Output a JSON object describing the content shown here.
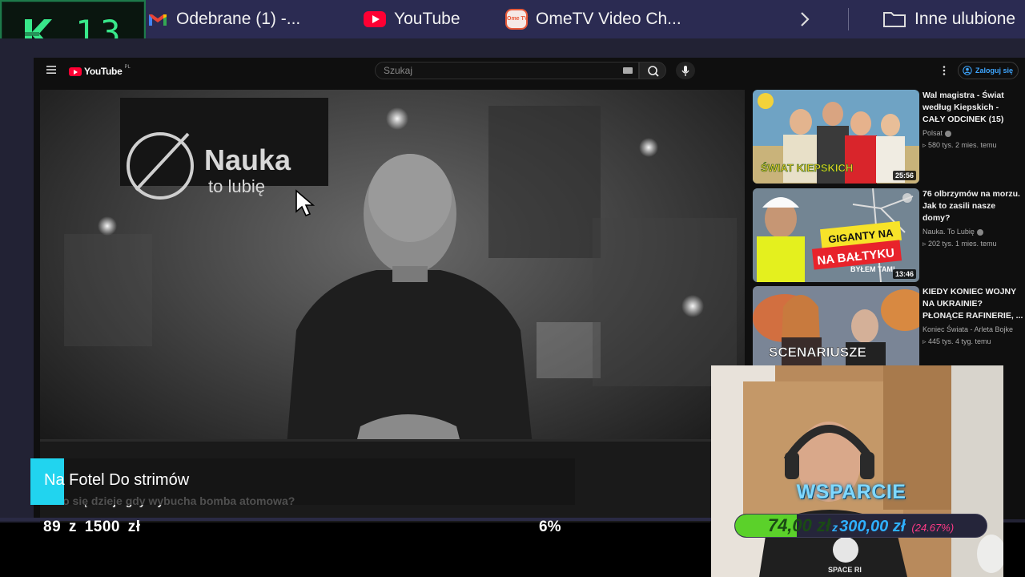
{
  "browser": {
    "bookmarks": [
      {
        "label": "Odebrane (1) -...",
        "icon": "gmail-icon"
      },
      {
        "label": "YouTube",
        "icon": "youtube-icon"
      },
      {
        "label": "OmeTV Video Ch...",
        "icon": "ometv-icon"
      }
    ],
    "other_bookmarks": "Inne ulubione",
    "ometv_icon_text": "Ome TV"
  },
  "counter": {
    "letter": "K",
    "value": "13"
  },
  "youtube": {
    "logo_text": "YouTube",
    "logo_suffix": "PL",
    "search_placeholder": "Szukaj",
    "signin_label": "Zaloguj się",
    "video": {
      "title": "Co się dzieje gdy wybucha bomba atomowa?",
      "logo_line1": "Nauka",
      "logo_line2": "to lubię"
    },
    "recommendations": [
      {
        "title": "Wal magistra - Świat według Kiepskich - CAŁY ODCINEK (15)",
        "channel": "Polsat",
        "meta": "▹ 580 tys.  2 mies. temu",
        "duration": "25:56",
        "thumb_text": "ŚWIAT KIEPSKICH"
      },
      {
        "title": "76 olbrzymów na morzu. Jak to zasili nasze domy?",
        "channel": "Nauka. To Lubię",
        "meta": "▹ 202 tys.  1 mies. temu",
        "duration": "13:46",
        "thumb_text_1": "GIGANTY NA",
        "thumb_text_2": "NA BAŁTYKU",
        "thumb_text_3": "BYŁEM TAM!"
      },
      {
        "title": "KIEDY KONIEC WOJNY NA UKRAINIE? PŁONĄCE RAFINERIE, ...",
        "channel": "Koniec Świata - Arleta Bojke",
        "meta": "▹ 445 tys.  4 tyg. temu",
        "thumb_text": "SCENARIUSZE"
      }
    ]
  },
  "overlay": {
    "alert_text": "Na Fotel Do strimów",
    "goal_progress": "89 z 1500 zł",
    "goal_percent": "6%",
    "goal_fraction": 0.06,
    "support_label": "WSPARCIE",
    "support_current": "74,00 zł",
    "support_z": "z",
    "support_goal": "300,00 zł",
    "support_percent": "(24.67%)",
    "support_fraction": 0.2467,
    "shirt_text": "SPACE RI"
  },
  "colors": {
    "counter_green": "#38e88a",
    "alert_cyan": "#21d4ef",
    "support_green": "#5bd12a",
    "support_blue": "#2fb0ff",
    "support_pink": "#ff3a86",
    "youtube_red": "#ff0033"
  }
}
